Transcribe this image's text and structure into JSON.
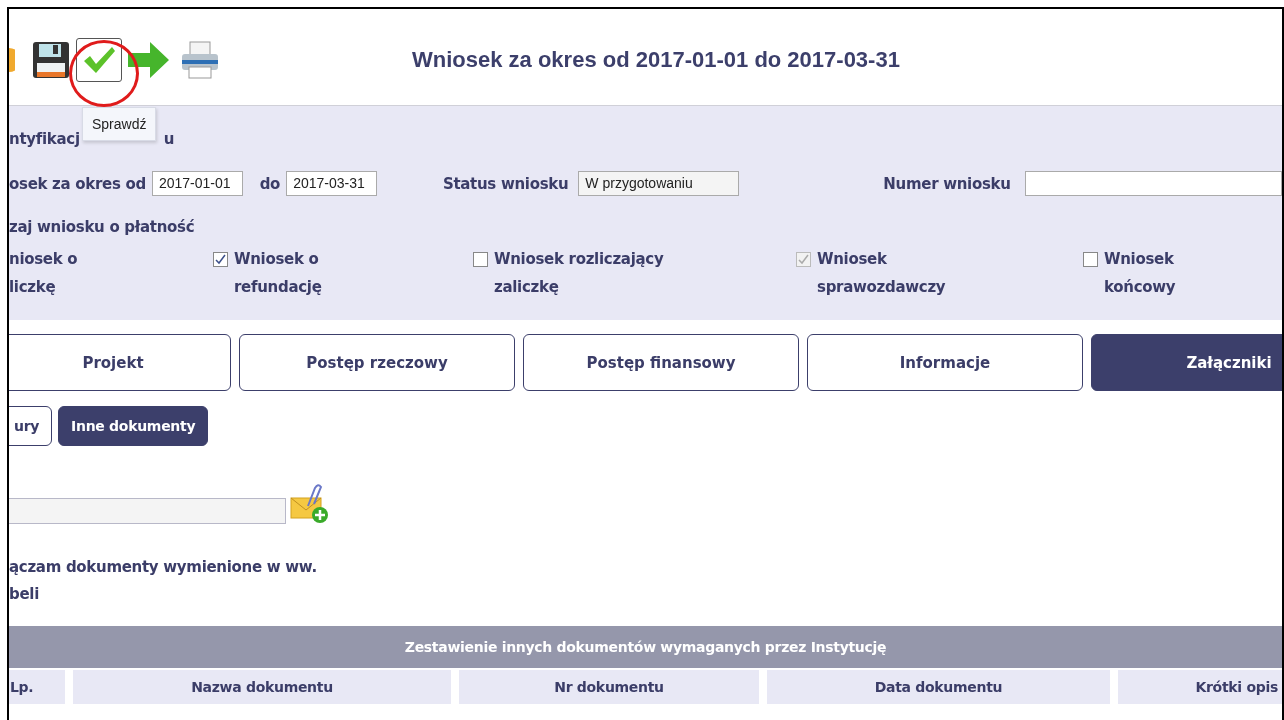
{
  "toolbar": {
    "title": "Wniosek za okres od 2017-01-01 do 2017-03-31",
    "tooltip": "Sprawdź"
  },
  "identification": {
    "heading": "ntyfikacj",
    "heading_tail": "u",
    "period_label": "osek za okres od",
    "period_from": "2017-01-01",
    "to_label": "do",
    "period_to": "2017-03-31",
    "status_label": "Status wniosku",
    "status_value": "W przygotowaniu",
    "number_label": "Numer wniosku",
    "type_label": "zaj wniosku o płatność",
    "checkboxes": [
      {
        "kind": "cut",
        "lines": [
          "niosek o",
          "liczkę"
        ]
      },
      {
        "kind": "box",
        "lines": [
          "Wniosek o",
          "refundację"
        ],
        "checked": true,
        "disabled": false
      },
      {
        "kind": "box",
        "lines": [
          "Wniosek rozliczający",
          "zaliczkę"
        ],
        "checked": false,
        "disabled": false
      },
      {
        "kind": "box",
        "lines": [
          "Wniosek",
          "sprawozdawczy"
        ],
        "checked": true,
        "disabled": true
      },
      {
        "kind": "box",
        "lines": [
          "Wniosek",
          "końcowy"
        ],
        "checked": false,
        "disabled": false
      }
    ]
  },
  "tabs": [
    {
      "label": "Projekt",
      "selected": false
    },
    {
      "label": "Postęp rzeczowy",
      "selected": false
    },
    {
      "label": "Postęp finansowy",
      "selected": false
    },
    {
      "label": "Informacje",
      "selected": false
    },
    {
      "label": "Załączniki",
      "selected": true
    }
  ],
  "subtabs": [
    {
      "label": "ury",
      "selected": false
    },
    {
      "label": "Inne dokumenty",
      "selected": true
    }
  ],
  "declaration": [
    "ączam dokumenty wymienione w ww.",
    "beli"
  ],
  "table": {
    "title": "Zestawienie innych dokumentów wymaganych przez Instytucję",
    "columns": [
      "Lp.",
      "Nazwa dokumentu",
      "Nr dokumentu",
      "Data dokumentu",
      "Krótki opis"
    ]
  }
}
